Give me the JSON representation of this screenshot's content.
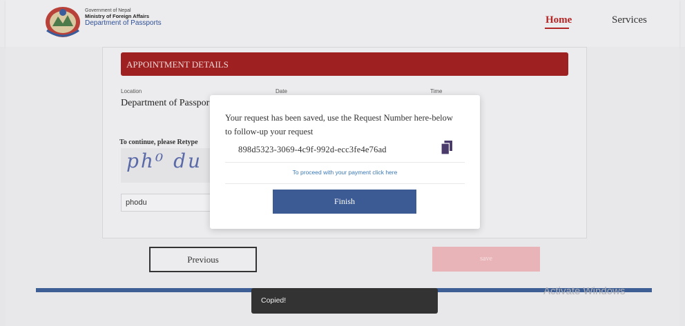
{
  "header": {
    "brand_line1": "Government of Nepal",
    "brand_line2": "Ministry of Foreign Affairs",
    "brand_line3": "Department of Passports",
    "nav_home": "Home",
    "nav_services": "Services"
  },
  "form": {
    "section_title": "APPOINTMENT DETAILS",
    "location_label": "Location",
    "location_value": "Department of Passpor",
    "date_label": "Date",
    "time_label": "Time",
    "captcha_label": "To continue, please Retype",
    "captcha_text": "ph⁰ du",
    "captcha_input_value": "phodu",
    "previous_label": "Previous",
    "save_label": "save"
  },
  "modal": {
    "message": "Your request has been saved, use the Request Number here-below to follow-up your request",
    "request_number": "898d5323-3069-4c9f-992d-ecc3fe4e76ad",
    "payment_link": "To proceed with your payment click here",
    "finish_label": "Finish"
  },
  "toast": {
    "message": "Copied!"
  },
  "watermark": "Activate Windows",
  "colors": {
    "accent": "#9e2020",
    "primary": "#3c5a94",
    "link": "#3a78b5"
  }
}
